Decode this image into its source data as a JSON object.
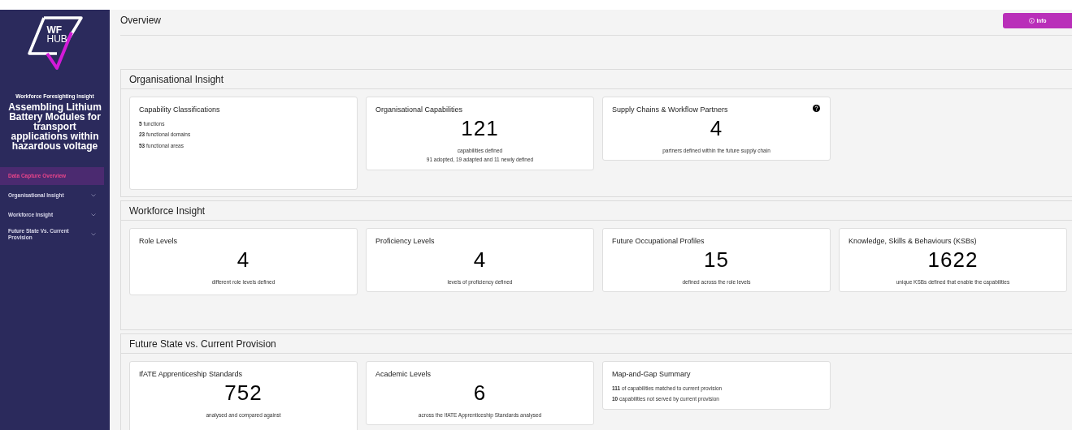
{
  "sidebar": {
    "logo_lines": [
      "WF",
      "HUB"
    ],
    "eyebrow": "Workforce Foresighting Insight",
    "title": "Assembling Lithium Battery Modules for transport applications within hazardous voltage",
    "items": [
      {
        "label": "Data Capture Overview",
        "selected": true,
        "expandable": false
      },
      {
        "label": "Organisational Insight",
        "selected": false,
        "expandable": true
      },
      {
        "label": "Workforce Insight",
        "selected": false,
        "expandable": true
      },
      {
        "label": "Future State Vs. Current Provision",
        "selected": false,
        "expandable": true
      }
    ]
  },
  "header": {
    "title": "Overview",
    "info_button": "Info"
  },
  "sections": [
    {
      "title": "Organisational Insight",
      "cards": [
        {
          "kind": "list",
          "title": "Capability Classifications",
          "lines": [
            "**5** functions",
            "**23** functional domains",
            "**53** functional areas"
          ]
        },
        {
          "kind": "number",
          "title": "Organisational Capabilities",
          "value": "121",
          "captions": [
            "capabilities defined",
            "91 adopted, 19 adapted and 11 newly defined"
          ]
        },
        {
          "kind": "number",
          "title": "Supply Chains & Workflow Partners",
          "value": "4",
          "captions": [
            "partners defined within the future supply chain"
          ],
          "help_icon": true
        }
      ]
    },
    {
      "title": "Workforce Insight",
      "cards": [
        {
          "kind": "number",
          "title": "Role Levels",
          "value": "4",
          "captions": [
            "different role levels defined"
          ]
        },
        {
          "kind": "number",
          "title": "Proficiency Levels",
          "value": "4",
          "captions": [
            "levels of proficiency defined"
          ]
        },
        {
          "kind": "number",
          "title": "Future Occupational Profiles",
          "value": "15",
          "captions": [
            "defined across the role levels"
          ]
        },
        {
          "kind": "number",
          "title": "Knowledge, Skills & Behaviours (KSBs)",
          "value": "1622",
          "captions": [
            "unique KSBs defined that enable the capabilities"
          ]
        }
      ]
    },
    {
      "title": "Future State vs. Current Provision",
      "cards": [
        {
          "kind": "number",
          "title": "IfATE Apprenticeship Standards",
          "value": "752",
          "captions": [
            "analysed and compared against"
          ]
        },
        {
          "kind": "number",
          "title": "Academic Levels",
          "value": "6",
          "captions": [
            "across the IfATE Apprenticeship Standards analysed"
          ]
        },
        {
          "kind": "list",
          "title": "Map-and-Gap Summary",
          "lines": [
            "**111** of capabilities matched to current provision",
            "**10** capabilities not served by current provision"
          ]
        }
      ]
    }
  ]
}
